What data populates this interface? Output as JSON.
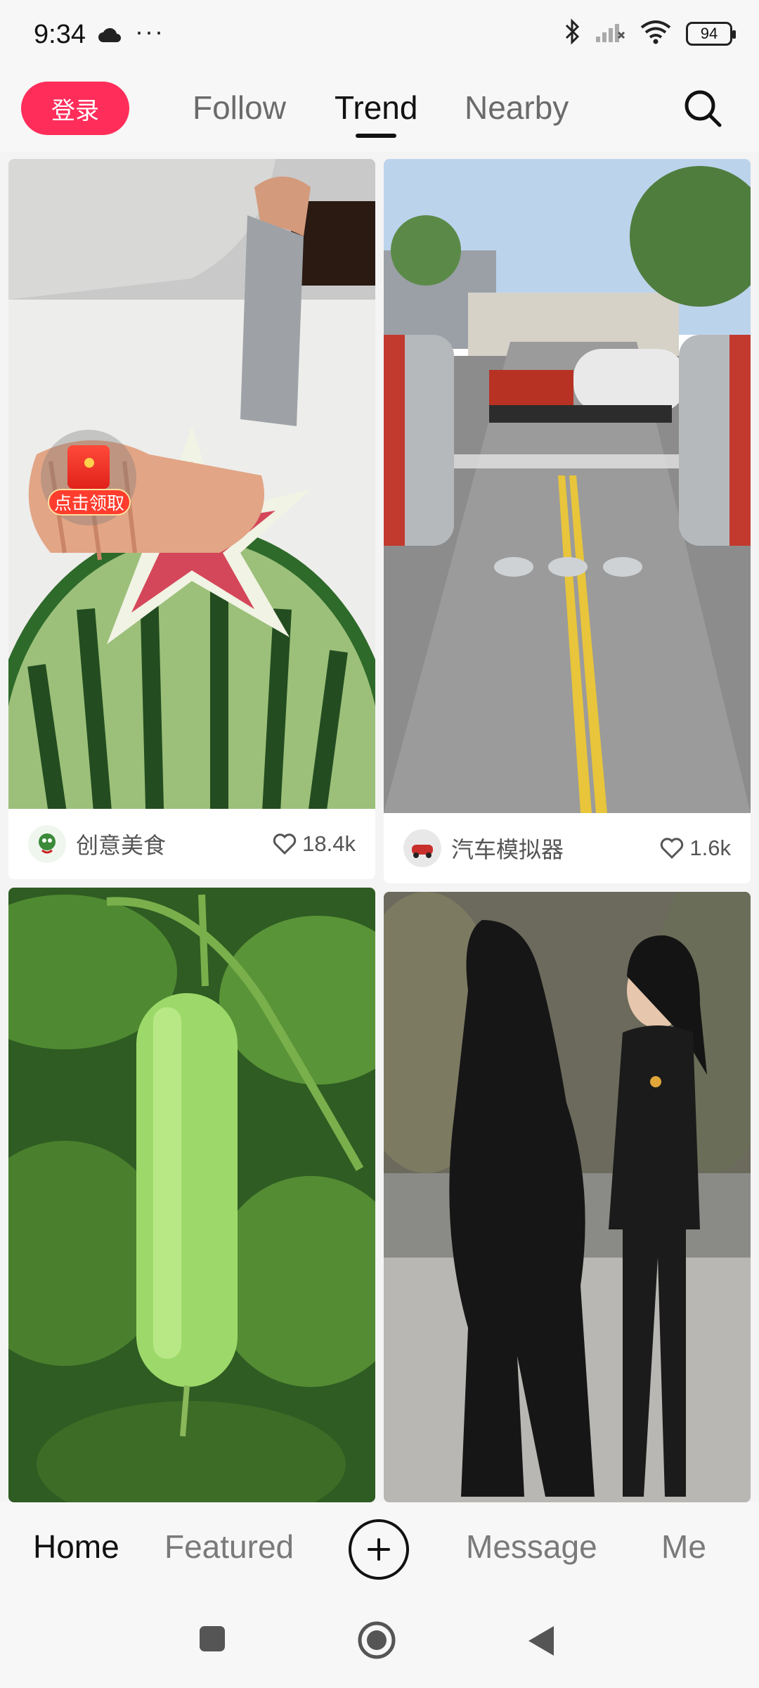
{
  "status_bar": {
    "time": "9:34",
    "dots": "···",
    "battery": "94"
  },
  "top_nav": {
    "login_label": "登录",
    "tabs": [
      {
        "label": "Follow",
        "active": false
      },
      {
        "label": "Trend",
        "active": true
      },
      {
        "label": "Nearby",
        "active": false
      }
    ]
  },
  "feed": {
    "cards": [
      {
        "author": "创意美食",
        "likes": "18.4k",
        "badge_label": "点击领取"
      },
      {
        "author": "汽车模拟器",
        "likes": "1.6k"
      },
      {},
      {}
    ]
  },
  "bottom_nav": {
    "items": [
      "Home",
      "Featured",
      "Message",
      "Me"
    ],
    "active": "Home"
  },
  "colors": {
    "accent": "#ff2d5a",
    "background": "#f4f4f4"
  }
}
